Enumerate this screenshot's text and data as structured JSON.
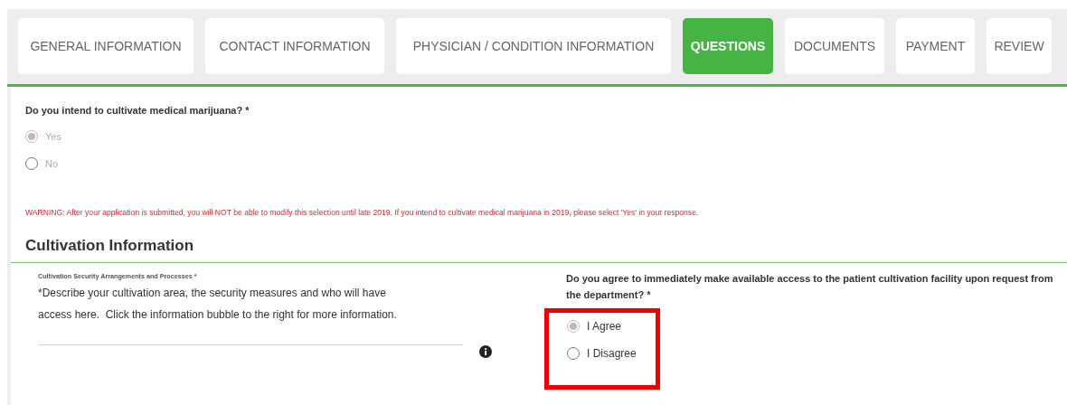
{
  "tabs": [
    {
      "label": "GENERAL INFORMATION",
      "selected": false
    },
    {
      "label": "CONTACT INFORMATION",
      "selected": false
    },
    {
      "label": "PHYSICIAN / CONDITION INFORMATION",
      "selected": false
    },
    {
      "label": "QUESTIONS",
      "selected": true
    },
    {
      "label": "DOCUMENTS",
      "selected": false
    },
    {
      "label": "PAYMENT",
      "selected": false
    },
    {
      "label": "REVIEW",
      "selected": false
    }
  ],
  "cultivate_question": {
    "label": "Do you intend to cultivate medical marijuana? *",
    "disabled": true,
    "options": [
      {
        "label": "Yes",
        "selected": true
      },
      {
        "label": "No",
        "selected": false
      }
    ]
  },
  "warning": "WARNING: After your application is submitted, you will NOT be able to modify this selection until late 2019. If you intend to cultivate medical marijuana in 2019, please select 'Yes' in your response.",
  "section": {
    "title": "Cultivation Information",
    "security_field": {
      "label": "Cultivation Security Arrangements and Processes *",
      "placeholder": "*Describe your cultivation area, the security measures and who will have access here.  Click the information bubble to the right for more information."
    },
    "access_question": {
      "label": "Do you agree to immediately make available access to the patient cultivation facility upon request from the department? *",
      "highlighted": true,
      "options": [
        {
          "label": "I Agree",
          "selected": true
        },
        {
          "label": "I Disagree",
          "selected": false
        }
      ]
    }
  }
}
